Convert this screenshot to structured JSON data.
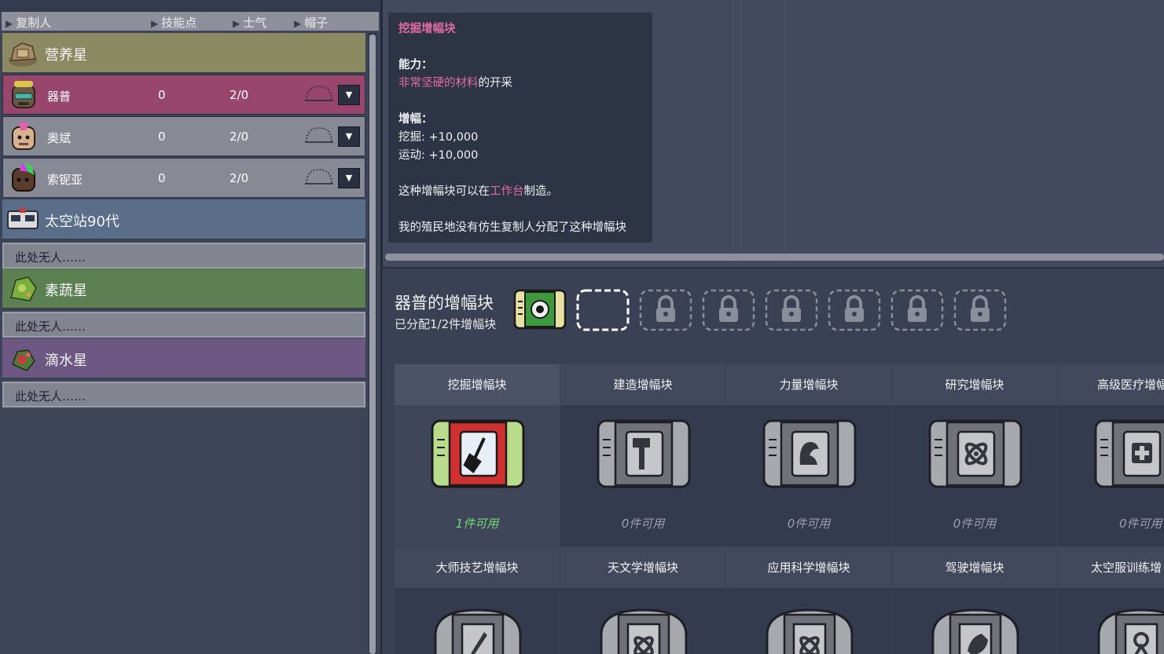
{
  "header": {
    "col_duplicant": "复制人",
    "col_skill": "技能点",
    "col_morale": "士气",
    "col_hat": "帽子"
  },
  "worlds": [
    {
      "name": "营养星",
      "color": "#8c8a62",
      "icon": "asteroid-icon",
      "duplicants": [
        {
          "name": "器普",
          "skill_points": "0",
          "morale": "2/0",
          "color": "#98466c",
          "avatar": "avatar-qipu"
        },
        {
          "name": "奥斌",
          "skill_points": "0",
          "morale": "2/0",
          "color": "#878995",
          "avatar": "avatar-aobin"
        },
        {
          "name": "索铌亚",
          "skill_points": "0",
          "morale": "2/0",
          "color": "#878995",
          "avatar": "avatar-suoniya"
        }
      ]
    },
    {
      "name": "太空站90代",
      "color": "#5a6e89",
      "icon": "space-station-icon",
      "empty_text": "此处无人……"
    },
    {
      "name": "素蔬星",
      "color": "#5d8053",
      "icon": "veggie-planet-icon",
      "empty_text": "此处无人……"
    },
    {
      "name": "滴水星",
      "color": "#6d5883",
      "icon": "water-planet-icon",
      "empty_text": "此处无人……"
    }
  ],
  "tooltip": {
    "title": "挖掘增幅块",
    "ability_label": "能力：",
    "ability_highlight": "非常坚硬的材料",
    "ability_rest": "的开采",
    "boost_label": "增幅：",
    "boost_1": "挖掘: +10,000",
    "boost_2": "运动: +10,000",
    "craft_prefix": "这种增幅块可以在",
    "craft_station": "工作台",
    "craft_suffix": "制造。",
    "note": "我的殖民地没有仿生复制人分配了这种增幅块"
  },
  "equipped": {
    "title": "器普的增幅块",
    "subtitle": "已分配1/2件增幅块",
    "slots": [
      "equipped-gear-booster",
      "empty-slot",
      "locked",
      "locked",
      "locked",
      "locked",
      "locked",
      "locked"
    ]
  },
  "boosters": [
    {
      "name": "挖掘增幅块",
      "available": "1件可用",
      "selected": true,
      "icon": "shovel-icon"
    },
    {
      "name": "建造增幅块",
      "available": "0件可用",
      "icon": "hammer-icon"
    },
    {
      "name": "力量增幅块",
      "available": "0件可用",
      "icon": "strength-icon"
    },
    {
      "name": "研究增幅块",
      "available": "0件可用",
      "icon": "atom-icon"
    },
    {
      "name": "高级医疗增幅",
      "available": "0件可用",
      "icon": "medkit-icon"
    },
    {
      "name": "大师技艺增幅块",
      "icon": "pencil-icon"
    },
    {
      "name": "天文学增幅块",
      "icon": "atom-icon"
    },
    {
      "name": "应用科学增幅块",
      "icon": "atom-icon"
    },
    {
      "name": "驾驶增幅块",
      "icon": "rocket-icon"
    },
    {
      "name": "太空服训练增",
      "icon": "suit-icon"
    }
  ]
}
